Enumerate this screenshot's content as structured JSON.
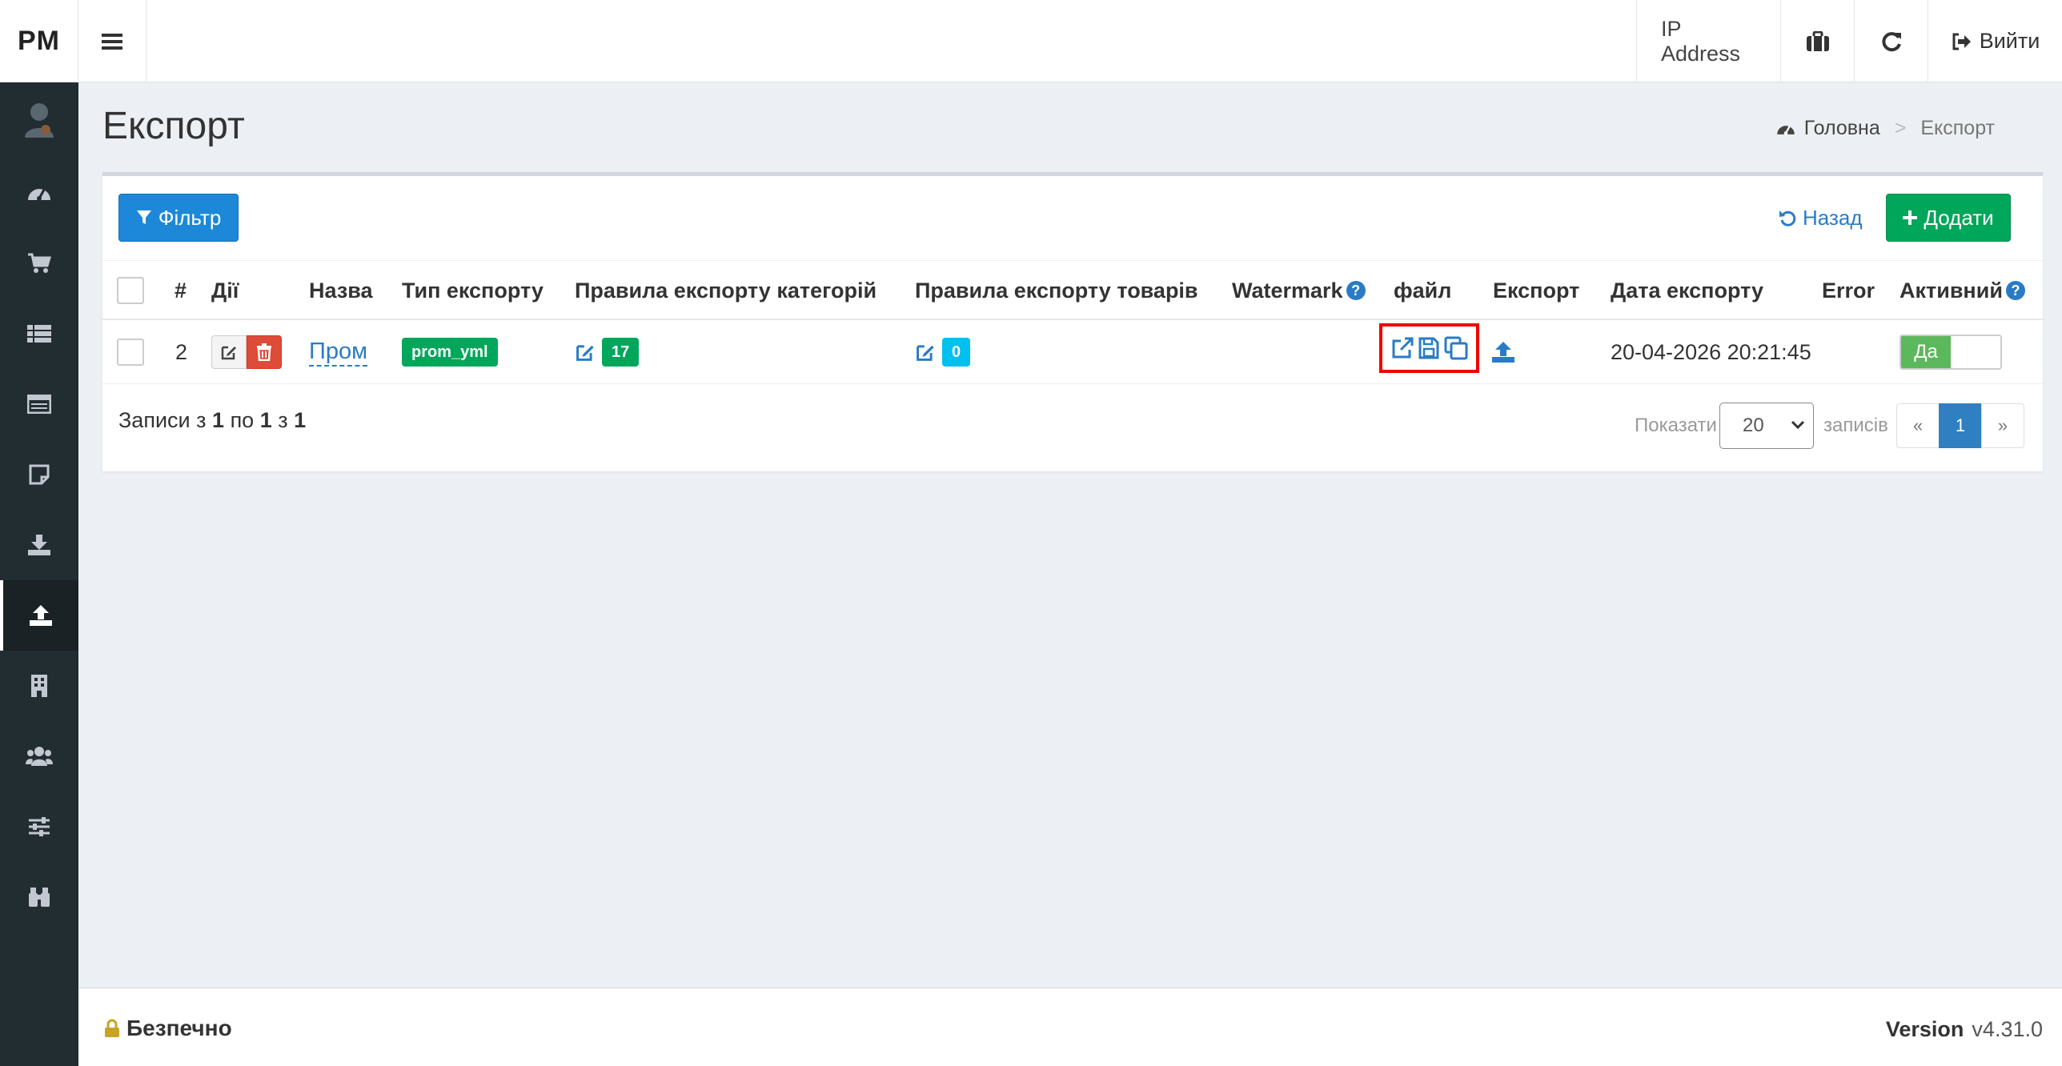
{
  "header": {
    "logo": "PM",
    "ip_label": "IP Address",
    "logout_label": "Вийти"
  },
  "sidebar": {
    "items": [
      {
        "icon": "user-avatar-icon"
      },
      {
        "icon": "dashboard-icon"
      },
      {
        "icon": "cart-icon"
      },
      {
        "icon": "list-icon"
      },
      {
        "icon": "table-icon"
      },
      {
        "icon": "note-icon"
      },
      {
        "icon": "download-icon"
      },
      {
        "icon": "upload-icon",
        "active": true
      },
      {
        "icon": "building-icon"
      },
      {
        "icon": "users-icon"
      },
      {
        "icon": "sliders-icon"
      },
      {
        "icon": "binoculars-icon"
      }
    ]
  },
  "page": {
    "title": "Експорт",
    "breadcrumb_home": "Головна",
    "breadcrumb_sep": ">",
    "breadcrumb_current": "Експорт"
  },
  "toolbar": {
    "filter_label": "Фільтр",
    "back_label": "Назад",
    "add_label": "Додати"
  },
  "table": {
    "columns": {
      "num": "#",
      "actions": "Дії",
      "name": "Назва",
      "type": "Тип експорту",
      "cat_rules": "Правила експорту категорій",
      "prod_rules": "Правила експорту товарів",
      "watermark": "Watermark",
      "file": "файл",
      "export": "Експорт",
      "date": "Дата експорту",
      "error": "Error",
      "active": "Активний"
    },
    "help_glyph": "?",
    "rows": [
      {
        "num": "2",
        "name": "Пром",
        "type": "prom_yml",
        "cat_rules_count": "17",
        "prod_rules_count": "0",
        "date": "20-04-2026 20:21:45",
        "error": "",
        "active_label": "Да"
      }
    ]
  },
  "records": {
    "prefix": "Записи з",
    "from": "1",
    "mid1": "по",
    "to": "1",
    "mid2": "з",
    "total": "1"
  },
  "pagination": {
    "show_label": "Показати",
    "page_size": "20",
    "entries_label": "записів",
    "prev": "«",
    "current": "1",
    "next": "»"
  },
  "footer": {
    "secure_label": "Безпечно",
    "version_label": "Version",
    "version_value": "v4.31.0"
  },
  "colors": {
    "sidebar_bg": "#222d32",
    "primary": "#1e88d8",
    "success": "#00a65a",
    "danger": "#dd4b39",
    "info": "#00c0ef",
    "highlight": "#e00000"
  }
}
